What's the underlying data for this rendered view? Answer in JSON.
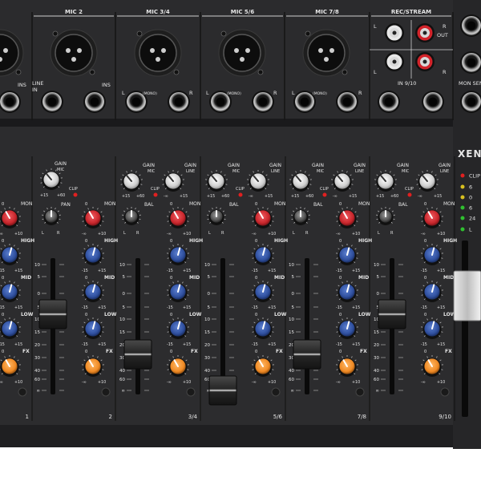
{
  "device": {
    "brand_partial": "XENY"
  },
  "top_panel": {
    "sections": [
      {
        "title": "MIC 2"
      },
      {
        "title": "MIC 3/4"
      },
      {
        "title": "MIC 5/6"
      },
      {
        "title": "MIC 7/8"
      },
      {
        "title": "REC/STREAM"
      }
    ],
    "labels": {
      "ins": "INS",
      "line_in": "LINE\nIN",
      "mono": "(MONO)",
      "l": "L",
      "r": "R",
      "out": "OUT",
      "in_9_10": "IN 9/10",
      "mon_send": "MON SEN"
    }
  },
  "channel_labels": {
    "gain": "GAIN",
    "mic": "MIC",
    "line": "LINE",
    "clip": "CLIP",
    "pan": "PAN",
    "bal": "BAL",
    "mon": "MON",
    "high": "HIGH",
    "mid": "MID",
    "low": "LOW",
    "fx": "FX",
    "plus15": "+15",
    "minus15": "-15",
    "plus60": "+60",
    "minus_inf": "-∞",
    "inf": "∞",
    "zero": "0",
    "plus10": "+10",
    "l": "L",
    "r": "R"
  },
  "fader_scale": [
    "10",
    "5",
    "0",
    "5",
    "10",
    "15",
    "20",
    "30",
    "40",
    "60",
    "∞"
  ],
  "channels": [
    {
      "number": "1"
    },
    {
      "number": "2"
    },
    {
      "number": "3/4"
    },
    {
      "number": "5/6"
    },
    {
      "number": "7/8"
    },
    {
      "number": "9/10"
    }
  ],
  "meter": {
    "labels": [
      "CLIP",
      "6",
      "0",
      "6",
      "24",
      "L"
    ]
  },
  "colors": {
    "panel": "#2b2b2d",
    "panel_dark": "#1c1c1e",
    "mon_knob": "#c8262c",
    "eq_knob": "#2f4f9e",
    "fx_knob": "#f08a24",
    "gain_knob": "#e8e8e8",
    "led_red": "#e02020",
    "led_yellow": "#d8c020",
    "led_green": "#30c030"
  }
}
